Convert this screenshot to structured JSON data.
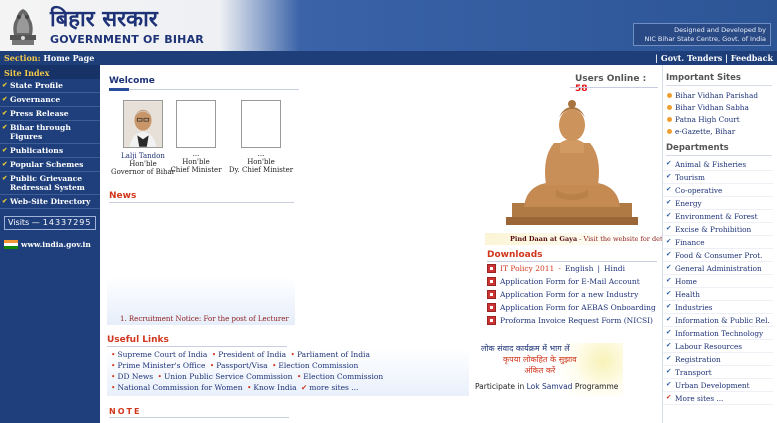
{
  "header": {
    "title_hindi": "बिहार सरकार",
    "title_english": "GOVERNMENT OF BIHAR",
    "designed_by_line1": "Designed and Developed by",
    "designed_by_line2": "NIC Bihar State Centre, Govt. of India"
  },
  "section_bar": {
    "prefix": "Section:",
    "page": "Home Page",
    "links": [
      "Govt. Tenders",
      "Feedback"
    ]
  },
  "left_sidebar": {
    "title": "Site Index",
    "items": [
      "State Profile",
      "Governance",
      "Press Release",
      "Bihar through Figures",
      "Publications",
      "Popular Schemes",
      "Public Grievance Redressal System",
      "Web-Site Directory"
    ],
    "visits_label": "Visits",
    "visits_count": "14337295",
    "india_link": "www.india.gov.in"
  },
  "welcome": {
    "title": "Welcome",
    "users_online_label": "Users Online :",
    "users_online_count": "58",
    "people": [
      {
        "name": "Lalji Tandon",
        "line2": "Hon'ble",
        "role": "Governor of Bihar"
      },
      {
        "name": "...",
        "line2": "Hon'ble",
        "role": "Chief Minister"
      },
      {
        "name": "...",
        "line2": "Hon'ble",
        "role": "Dy. Chief Minister"
      }
    ]
  },
  "news": {
    "title": "News",
    "item": "1. Recruitment Notice: For the post of Lecturer"
  },
  "gaya": {
    "bold": "Pind Daan at Gaya",
    "text": " - Visit the website for details..."
  },
  "downloads": {
    "title": "Downloads",
    "it_policy": "IT Policy 2011",
    "it_sep": " - ",
    "english": "English",
    "pipe": " | ",
    "hindi": "Hindi",
    "items": [
      "Application Form for E-Mail Account",
      "Application Form for a new Industry",
      "Application Form for AEBAS Onboarding",
      "Proforma Invoice Request Form (NICSI)"
    ]
  },
  "useful_links": {
    "title": "Useful Links",
    "rows": [
      [
        "Supreme Court of India",
        "President of India",
        "Parliament of India"
      ],
      [
        "Prime Minister's Office",
        "Passport/Visa",
        "Election Commission"
      ],
      [
        "DD News",
        "Union Public Service Commission",
        "Election Commission"
      ],
      [
        "National Commission for Women",
        "Know India",
        "more sites ..."
      ]
    ]
  },
  "samvad": {
    "line1": "लोक संवाद कार्यक्रम में भाग लें",
    "line2": "कृपया लोकहित के सुझाव",
    "line3": "अंकित करें",
    "participate": "Participate in",
    "link": "Lok Samvad",
    "suffix": "Programme"
  },
  "note": {
    "title": "NOTE"
  },
  "important_sites": {
    "title": "Important Sites",
    "items": [
      "Bihar Vidhan Parishad",
      "Bihar Vidhan Sabha",
      "Patna High Court",
      "e-Gazette, Bihar"
    ]
  },
  "departments": {
    "title": "Departments",
    "items": [
      "Animal & Fisheries",
      "Tourism",
      "Co-operative",
      "Energy",
      "Environment & Forest",
      "Excise & Prohibition",
      "Finance",
      "Food & Consumer Prot.",
      "General Administration",
      "Home",
      "Health",
      "Industries",
      "Information & Public Rel.",
      "Information Technology",
      "Labour Resources",
      "Registration",
      "Transport",
      "Urban Development"
    ],
    "more": "More sites ..."
  }
}
